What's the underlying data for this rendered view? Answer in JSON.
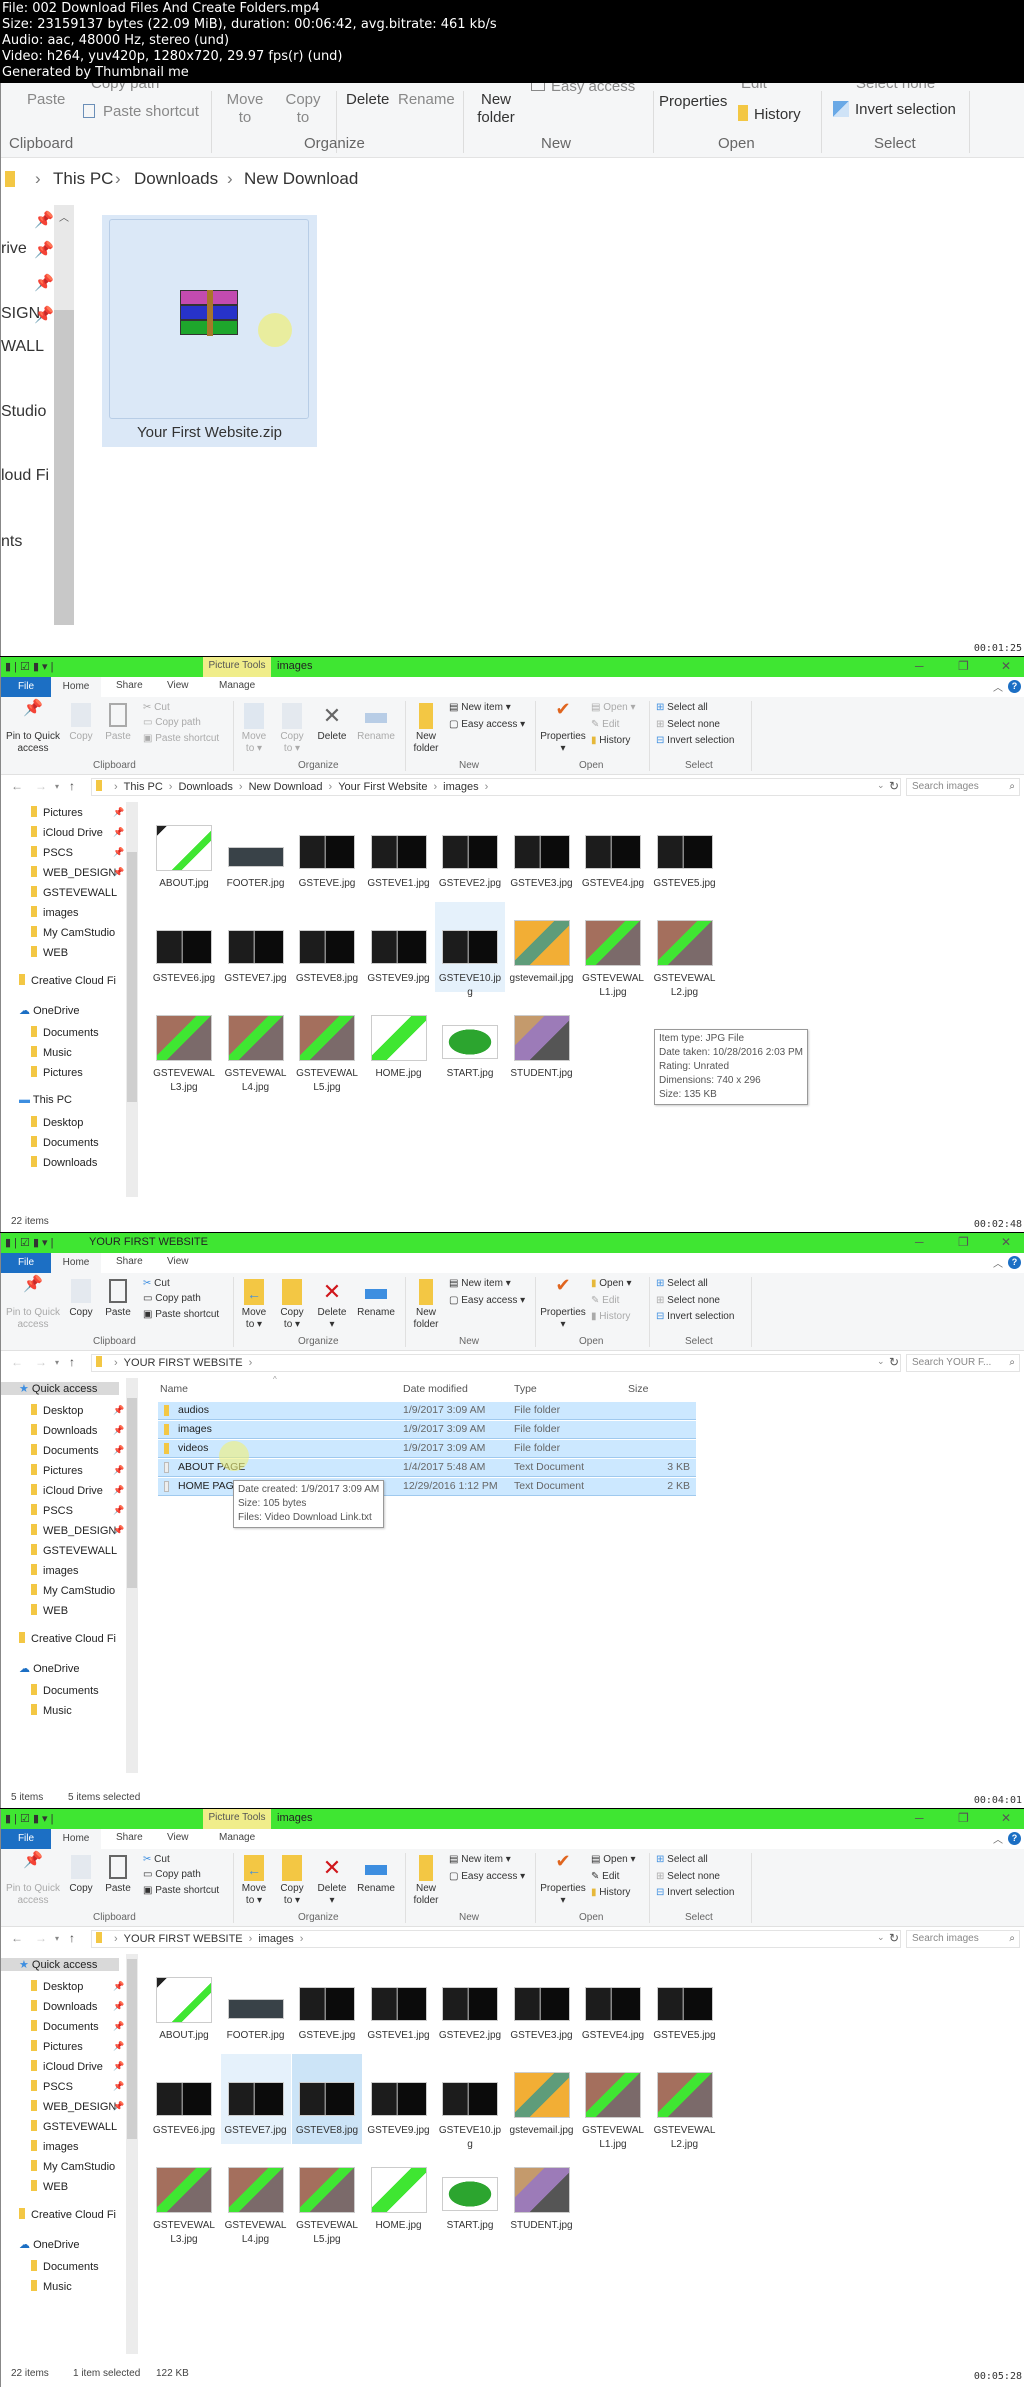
{
  "video_info": {
    "line1": "File: 002 Download Files And Create Folders.mp4",
    "line2": "Size: 23159137 bytes (22.09 MiB), duration: 00:06:42, avg.bitrate: 461 kb/s",
    "line3": "Audio: aac, 48000 Hz, stereo (und)",
    "line4": "Video: h264, yuv420p, 1280x720, 29.97 fps(r) (und)",
    "line5": "Generated by Thumbnail me"
  },
  "frame1": {
    "timestamp": "00:01:25",
    "ribbon": {
      "copy_path": "Copy path",
      "paste": "Paste",
      "paste_shortcut": "Paste shortcut",
      "move_to": "Move to",
      "copy_to": "Copy to",
      "delete": "Delete",
      "rename": "Rename",
      "new_folder": "New folder",
      "easy_access": "Easy access",
      "properties": "Properties",
      "edit": "Edit",
      "history": "History",
      "select_none": "Select none",
      "invert_selection": "Invert selection",
      "groups": [
        "Clipboard",
        "Organize",
        "New",
        "Open",
        "Select"
      ]
    },
    "breadcrumb": [
      "This PC",
      "Downloads",
      "New Download"
    ],
    "sidebar_partial": [
      "rive",
      "SIGN",
      "WALL",
      "Studio",
      "loud Fi",
      "nts"
    ],
    "file": {
      "name": "Your First Website.zip",
      "icon": "winrar-archive-icon"
    }
  },
  "frame2": {
    "timestamp": "00:02:48",
    "title": {
      "context_tab": "Picture Tools",
      "folder": "images"
    },
    "tabs": {
      "file": "File",
      "home": "Home",
      "share": "Share",
      "view": "View",
      "manage": "Manage"
    },
    "ribbon": {
      "pin": "Pin to Quick access",
      "copy": "Copy",
      "paste": "Paste",
      "cut": "Cut",
      "copy_path": "Copy path",
      "paste_shortcut": "Paste shortcut",
      "move_to": "Move to",
      "copy_to": "Copy to",
      "delete": "Delete",
      "rename": "Rename",
      "new_folder": "New folder",
      "new_item": "New item",
      "easy_access": "Easy access",
      "properties": "Properties",
      "open": "Open",
      "edit": "Edit",
      "history": "History",
      "select_all": "Select all",
      "select_none": "Select none",
      "invert_selection": "Invert selection",
      "groups": {
        "clipboard": "Clipboard",
        "organize": "Organize",
        "new": "New",
        "open": "Open",
        "select": "Select"
      }
    },
    "address": {
      "parts": [
        "This PC",
        "Downloads",
        "New Download",
        "Your First Website",
        "images"
      ],
      "search_placeholder": "Search images"
    },
    "sidebar": [
      "Pictures",
      "iCloud Drive",
      "PSCS",
      "WEB_DESIGN",
      "GSTEVEWALL",
      "images",
      "My CamStudio",
      "WEB",
      "Creative Cloud Fi",
      "OneDrive",
      "Documents",
      "Music",
      "Pictures",
      "This PC",
      "Desktop",
      "Documents",
      "Downloads"
    ],
    "files": [
      "ABOUT.jpg",
      "FOOTER.jpg",
      "GSTEVE.jpg",
      "GSTEVE1.jpg",
      "GSTEVE2.jpg",
      "GSTEVE3.jpg",
      "GSTEVE4.jpg",
      "GSTEVE5.jpg",
      "GSTEVE6.jpg",
      "GSTEVE7.jpg",
      "GSTEVE8.jpg",
      "GSTEVE9.jpg",
      "GSTEVE10.jpg",
      "gstevemail.jpg",
      "GSTEVEWALL1.jpg",
      "GSTEVEWALL2.jpg",
      "GSTEVEWALL3.jpg",
      "GSTEVEWALL4.jpg",
      "GSTEVEWALL5.jpg",
      "HOME.jpg",
      "START.jpg",
      "STUDENT.jpg"
    ],
    "tooltip": {
      "type": "Item type: JPG File",
      "date": "Date taken: 10/28/2016 2:03 PM",
      "rating": "Rating: Unrated",
      "dimensions": "Dimensions: 740 x 296",
      "size": "Size: 135 KB"
    },
    "status": "22 items"
  },
  "frame3": {
    "timestamp": "00:04:01",
    "title": {
      "folder": "YOUR FIRST WEBSITE"
    },
    "address": {
      "parts": [
        "YOUR FIRST WEBSITE"
      ],
      "search_placeholder": "Search YOUR F..."
    },
    "sidebar": [
      "Quick access",
      "Desktop",
      "Downloads",
      "Documents",
      "Pictures",
      "iCloud Drive",
      "PSCS",
      "WEB_DESIGN",
      "GSTEVEWALL",
      "images",
      "My CamStudio",
      "WEB",
      "Creative Cloud Fi",
      "OneDrive",
      "Documents",
      "Music"
    ],
    "columns": {
      "name": "Name",
      "date": "Date modified",
      "type": "Type",
      "size": "Size"
    },
    "rows": [
      {
        "name": "audios",
        "date": "1/9/2017 3:09 AM",
        "type": "File folder",
        "size": ""
      },
      {
        "name": "images",
        "date": "1/9/2017 3:09 AM",
        "type": "File folder",
        "size": ""
      },
      {
        "name": "videos",
        "date": "1/9/2017 3:09 AM",
        "type": "File folder",
        "size": ""
      },
      {
        "name": "ABOUT PAGE",
        "date": "1/4/2017 5:48 AM",
        "type": "Text Document",
        "size": "3 KB"
      },
      {
        "name": "HOME PAGE",
        "date": "12/29/2016 1:12 PM",
        "type": "Text Document",
        "size": "2 KB"
      }
    ],
    "tooltip": {
      "created": "Date created: 1/9/2017 3:09 AM",
      "size": "Size: 105 bytes",
      "files": "Files: Video Download Link.txt"
    },
    "status": {
      "count": "5 items",
      "selected": "5 items selected"
    }
  },
  "frame4": {
    "timestamp": "00:05:28",
    "address": {
      "parts": [
        "YOUR FIRST WEBSITE",
        "images"
      ],
      "search_placeholder": "Search images"
    },
    "sidebar": [
      "Quick access",
      "Desktop",
      "Downloads",
      "Documents",
      "Pictures",
      "iCloud Drive",
      "PSCS",
      "WEB_DESIGN",
      "GSTEVEWALL",
      "images",
      "My CamStudio",
      "WEB",
      "Creative Cloud Fi",
      "OneDrive",
      "Documents",
      "Music"
    ],
    "status": {
      "count": "22 items",
      "selected": "1 item selected",
      "size": "122 KB"
    }
  },
  "colors": {
    "title_bar": "#3fe632",
    "file_tab": "#1c6fc4",
    "picture_tools": "#f0ed8a",
    "selection": "#cce8ff"
  }
}
